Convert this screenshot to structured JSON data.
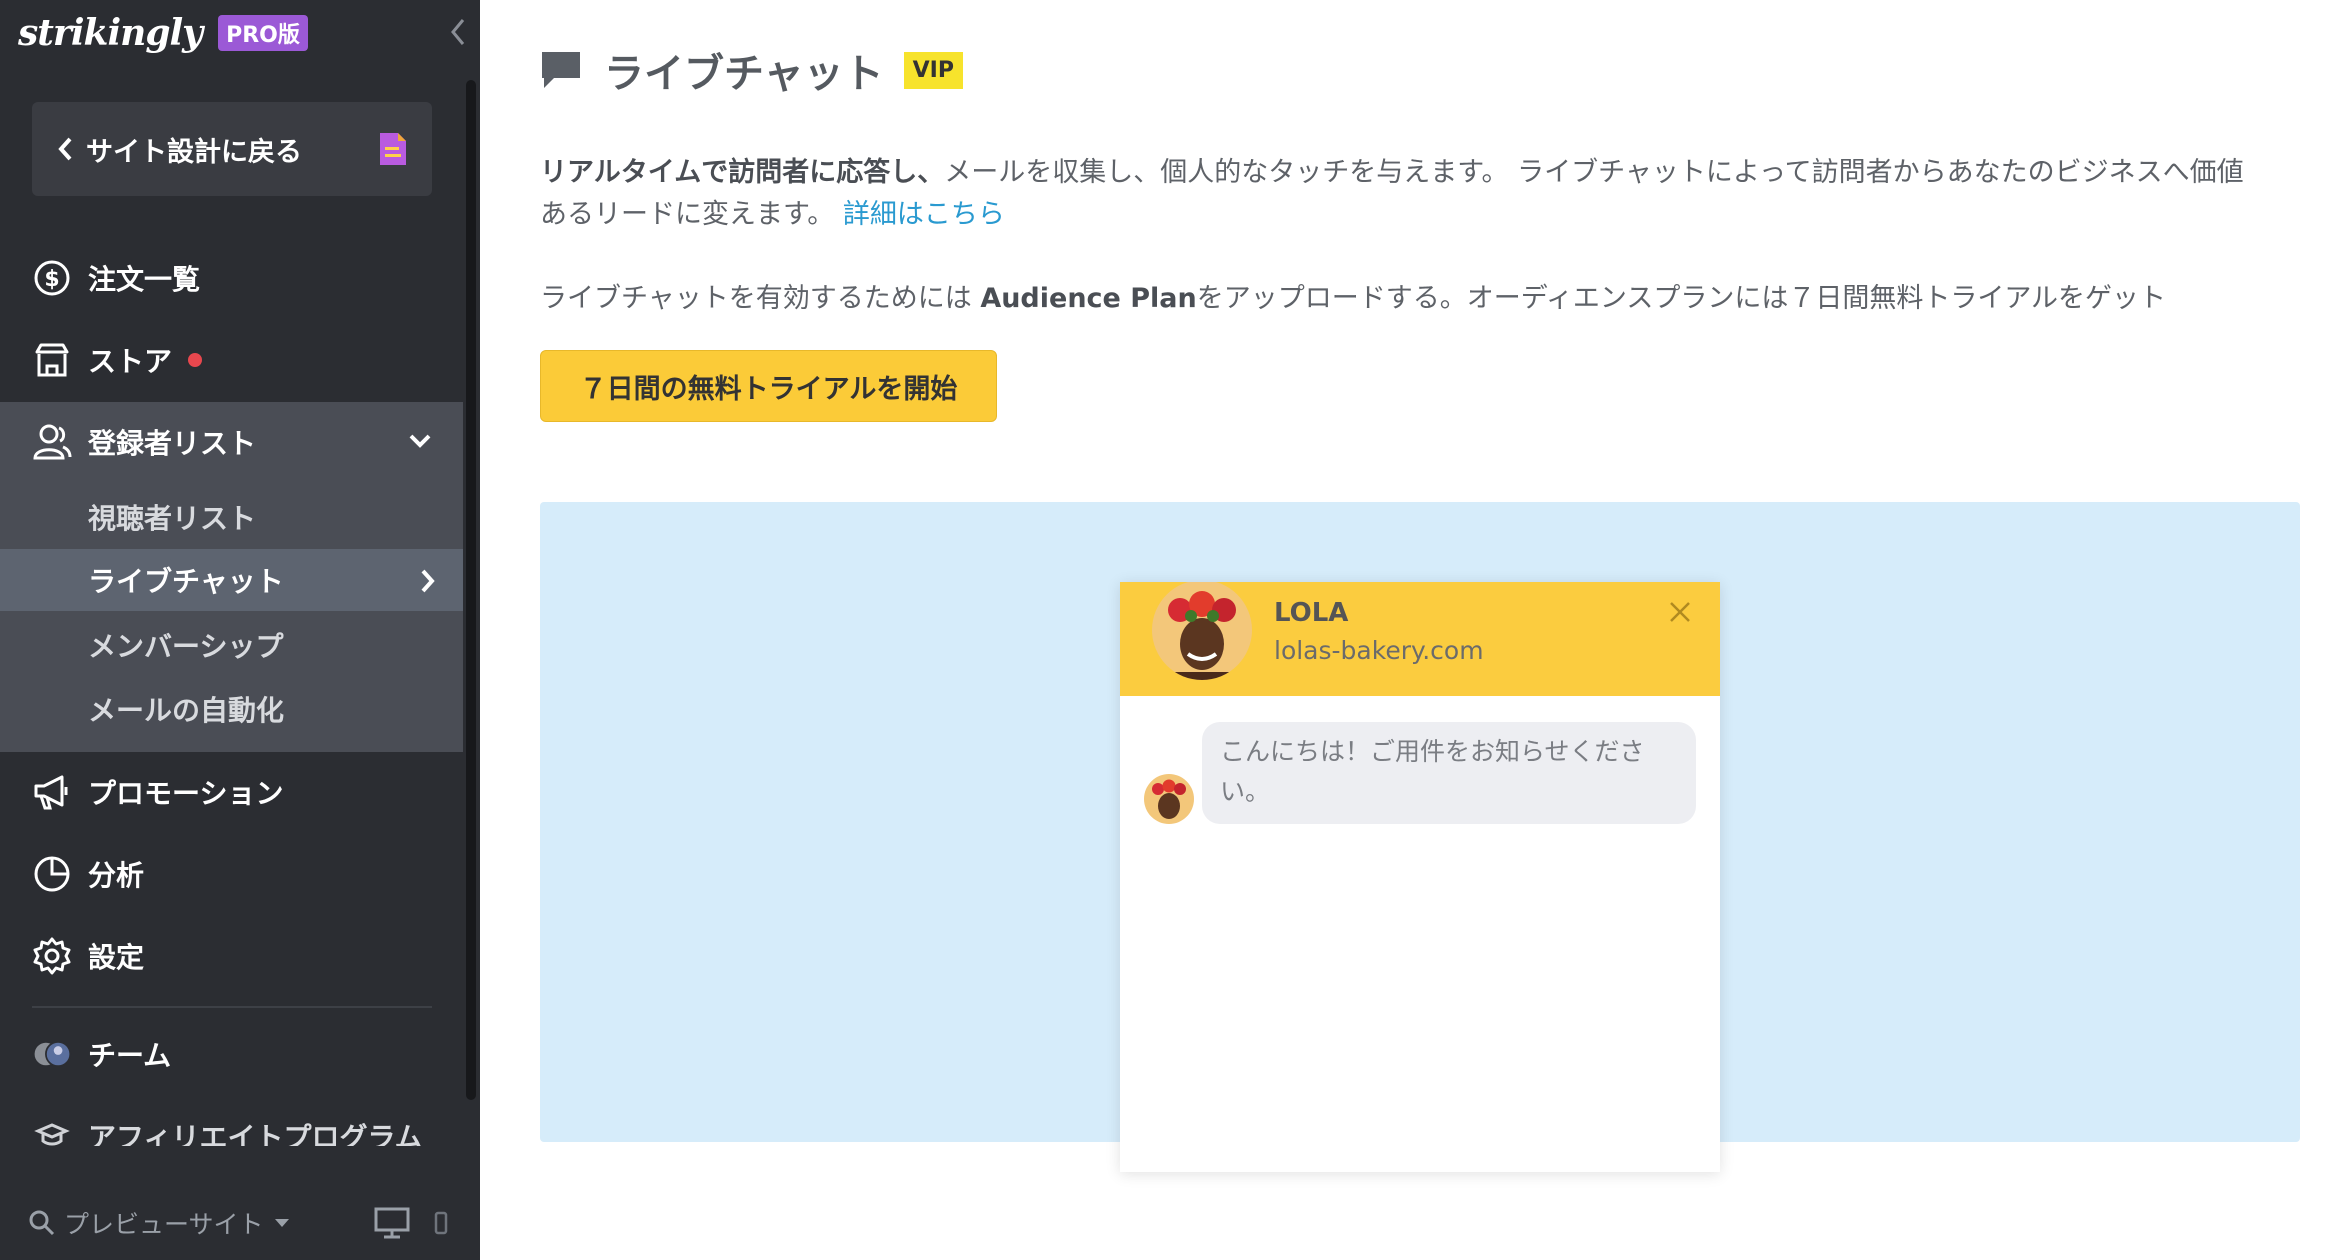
{
  "sidebar": {
    "logo": "strikingly",
    "pro_badge": "PRO版",
    "back_button": "サイト設計に戻る",
    "nav": {
      "orders": "注文一覧",
      "store": "ストア",
      "subscribers": "登録者リスト",
      "promotion": "プロモーション",
      "analytics": "分析",
      "settings": "設定",
      "team": "チーム",
      "affiliate": "アフィリエイトプログラム"
    },
    "subnav": {
      "audience_list": "視聴者リスト",
      "live_chat": "ライブチャット",
      "membership": "メンバーシップ",
      "email_automation": "メールの自動化"
    },
    "preview_site": "プレビューサイト"
  },
  "main": {
    "title": "ライブチャット",
    "vip_badge": "VIP",
    "intro_bold": "リアルタイムで訪問者に応答し、",
    "intro_rest": "メールを収集し、個人的なタッチを与えます。 ライブチャットによって訪問者からあなたのビジネスへ価値あるリードに変えます。",
    "intro_link": "詳細はこちら",
    "upgrade_before": "ライブチャットを有効するためには ",
    "upgrade_plan": "Audience Plan",
    "upgrade_after": "をアップロードする。オーディエンスプランには７日間無料トライアルをゲット",
    "trial_button": "７日間の無料トライアルを開始"
  },
  "chat_preview": {
    "name": "LOLA",
    "domain": "lolas-bakery.com",
    "message": "こんにちは！ご用件をお知らせください。"
  },
  "colors": {
    "sidebar_bg": "#2b2d32",
    "accent_yellow": "#fbcb38",
    "pro_purple": "#9b59d6",
    "link_blue": "#2a9ad0",
    "preview_bg": "#d6ecfa"
  },
  "icons": [
    "chevron-left-icon",
    "document-icon",
    "dollar-circle-icon",
    "store-icon",
    "users-icon",
    "chevron-down-icon",
    "chevron-right-icon",
    "megaphone-icon",
    "pie-chart-icon",
    "gear-icon",
    "team-avatars-icon",
    "affiliate-icon",
    "search-icon",
    "caret-down-icon",
    "desktop-icon",
    "mobile-icon",
    "chat-bubble-icon",
    "close-icon"
  ]
}
